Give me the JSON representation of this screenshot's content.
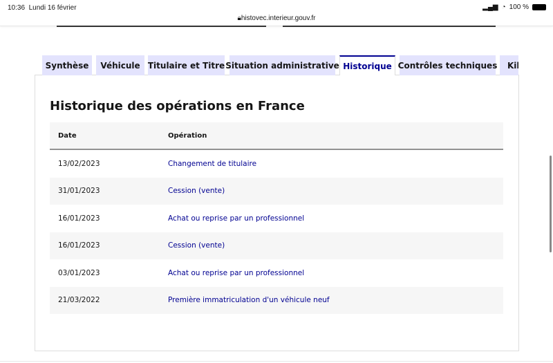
{
  "status_bar": {
    "time": "10:36",
    "date": "Lundi 16 février",
    "battery": "100 %"
  },
  "browser": {
    "url": "histovec.interieur.gouv.fr"
  },
  "tabs": [
    {
      "label": "Synthèse"
    },
    {
      "label": "Véhicule"
    },
    {
      "label": "Titulaire et Titre"
    },
    {
      "label": "Situation administrative"
    },
    {
      "label": "Historique",
      "active": true
    },
    {
      "label": "Contrôles techniques"
    },
    {
      "label": "Kilométrage"
    }
  ],
  "section": {
    "title": "Historique des opérations en France"
  },
  "table": {
    "headers": [
      "Date",
      "Opération"
    ],
    "rows": [
      {
        "date": "13/02/2023",
        "operation": "Changement de titulaire"
      },
      {
        "date": "31/01/2023",
        "operation": "Cession (vente)"
      },
      {
        "date": "16/01/2023",
        "operation": "Achat ou reprise par un professionnel"
      },
      {
        "date": "16/01/2023",
        "operation": "Cession (vente)"
      },
      {
        "date": "03/01/2023",
        "operation": "Achat ou reprise par un professionnel"
      },
      {
        "date": "21/03/2022",
        "operation": "Première immatriculation d'un véhicule neuf"
      }
    ]
  },
  "colors": {
    "accent": "#000091",
    "tab_bg": "#e3e3fd"
  }
}
